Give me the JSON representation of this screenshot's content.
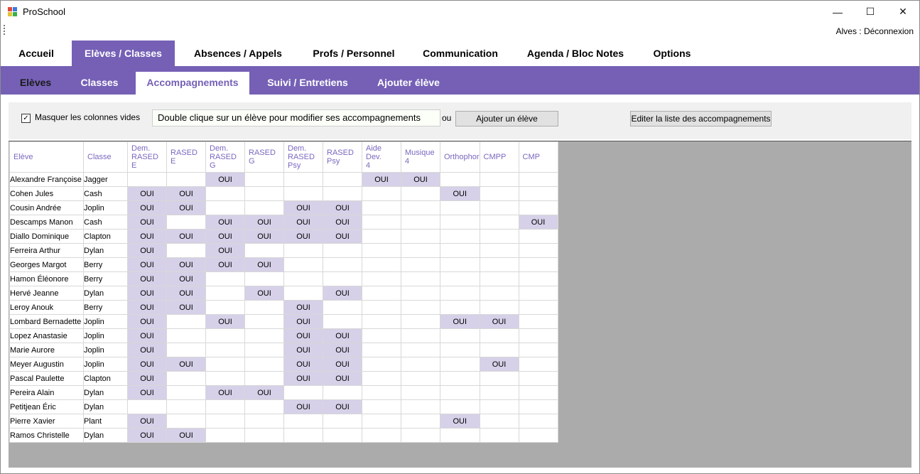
{
  "window": {
    "title": "ProSchool",
    "minimize_glyph": "—",
    "maximize_glyph": "☐",
    "close_glyph": "✕",
    "user_line": "Alves : Déconnexion"
  },
  "colors": {
    "accent": "#7560b6",
    "selected_cell": "#d6d0e8",
    "header_text": "#7b68c0"
  },
  "main_menu": [
    {
      "label": "Accueil"
    },
    {
      "label": "Elèves / Classes",
      "active": true
    },
    {
      "label": "Absences / Appels"
    },
    {
      "label": "Profs / Personnel"
    },
    {
      "label": "Communication"
    },
    {
      "label": "Agenda / Bloc Notes"
    },
    {
      "label": "Options"
    }
  ],
  "sub_menu": [
    {
      "label": "Elèves"
    },
    {
      "label": "Classes"
    },
    {
      "label": "Accompagnements",
      "active": true
    },
    {
      "label": "Suivi / Entretiens"
    },
    {
      "label": "Ajouter élève"
    }
  ],
  "toolbar": {
    "hide_empty_label": "Masquer les colonnes vides",
    "hide_empty_checked": true,
    "check_glyph": "✓",
    "hint": "Double clique sur un élève pour modifier ses accompagnements",
    "or_label": "ou",
    "add_student_label": "Ajouter un élève",
    "edit_list_label": "Editer la liste des accompagnements"
  },
  "grid": {
    "columns": [
      "Elève",
      "Classe",
      "Dem.\nRASED\nE",
      "RASED\nE",
      "Dem.\nRASED\nG",
      "RASED\nG",
      "Dem.\nRASED\nPsy",
      "RASED\nPsy",
      "Aide\nDev.\n4",
      "Musique\n4",
      "Orthophor",
      "CMPP",
      "CMP"
    ],
    "mark": "OUI",
    "rows": [
      {
        "name": "Alexandre Françoise",
        "class": "Jagger",
        "flags": [
          0,
          0,
          1,
          0,
          0,
          0,
          1,
          1,
          0,
          0,
          0
        ]
      },
      {
        "name": "Cohen Jules",
        "class": "Cash",
        "flags": [
          1,
          1,
          0,
          0,
          0,
          0,
          0,
          0,
          1,
          0,
          0
        ]
      },
      {
        "name": "Cousin Andrée",
        "class": "Joplin",
        "flags": [
          1,
          1,
          0,
          0,
          1,
          1,
          0,
          0,
          0,
          0,
          0
        ]
      },
      {
        "name": "Descamps Manon",
        "class": "Cash",
        "flags": [
          1,
          0,
          1,
          1,
          1,
          1,
          0,
          0,
          0,
          0,
          1
        ]
      },
      {
        "name": "Diallo Dominique",
        "class": "Clapton",
        "flags": [
          1,
          1,
          1,
          1,
          1,
          1,
          0,
          0,
          0,
          0,
          0
        ]
      },
      {
        "name": "Ferreira Arthur",
        "class": "Dylan",
        "flags": [
          1,
          0,
          1,
          0,
          0,
          0,
          0,
          0,
          0,
          0,
          0
        ]
      },
      {
        "name": "Georges Margot",
        "class": "Berry",
        "flags": [
          1,
          1,
          1,
          1,
          0,
          0,
          0,
          0,
          0,
          0,
          0
        ]
      },
      {
        "name": "Hamon Éléonore",
        "class": "Berry",
        "flags": [
          1,
          1,
          0,
          0,
          0,
          0,
          0,
          0,
          0,
          0,
          0
        ]
      },
      {
        "name": "Hervé Jeanne",
        "class": "Dylan",
        "flags": [
          1,
          1,
          0,
          1,
          0,
          1,
          0,
          0,
          0,
          0,
          0
        ]
      },
      {
        "name": "Leroy Anouk",
        "class": "Berry",
        "flags": [
          1,
          1,
          0,
          0,
          1,
          0,
          0,
          0,
          0,
          0,
          0
        ]
      },
      {
        "name": "Lombard Bernadette",
        "class": "Joplin",
        "flags": [
          1,
          0,
          1,
          0,
          1,
          0,
          0,
          0,
          1,
          1,
          0
        ]
      },
      {
        "name": "Lopez Anastasie",
        "class": "Joplin",
        "flags": [
          1,
          0,
          0,
          0,
          1,
          1,
          0,
          0,
          0,
          0,
          0
        ]
      },
      {
        "name": "Marie Aurore",
        "class": "Joplin",
        "flags": [
          1,
          0,
          0,
          0,
          1,
          1,
          0,
          0,
          0,
          0,
          0
        ]
      },
      {
        "name": "Meyer Augustin",
        "class": "Joplin",
        "flags": [
          1,
          1,
          0,
          0,
          1,
          1,
          0,
          0,
          0,
          1,
          0
        ]
      },
      {
        "name": "Pascal Paulette",
        "class": "Clapton",
        "flags": [
          1,
          0,
          0,
          0,
          1,
          1,
          0,
          0,
          0,
          0,
          0
        ]
      },
      {
        "name": "Pereira Alain",
        "class": "Dylan",
        "flags": [
          1,
          0,
          1,
          1,
          0,
          0,
          0,
          0,
          0,
          0,
          0
        ]
      },
      {
        "name": "Petitjean Éric",
        "class": "Dylan",
        "flags": [
          0,
          0,
          0,
          0,
          1,
          1,
          0,
          0,
          0,
          0,
          0
        ]
      },
      {
        "name": "Pierre Xavier",
        "class": "Plant",
        "flags": [
          1,
          0,
          0,
          0,
          0,
          0,
          0,
          0,
          1,
          0,
          0
        ]
      },
      {
        "name": "Ramos Christelle",
        "class": "Dylan",
        "flags": [
          1,
          1,
          0,
          0,
          0,
          0,
          0,
          0,
          0,
          0,
          0
        ]
      }
    ]
  }
}
